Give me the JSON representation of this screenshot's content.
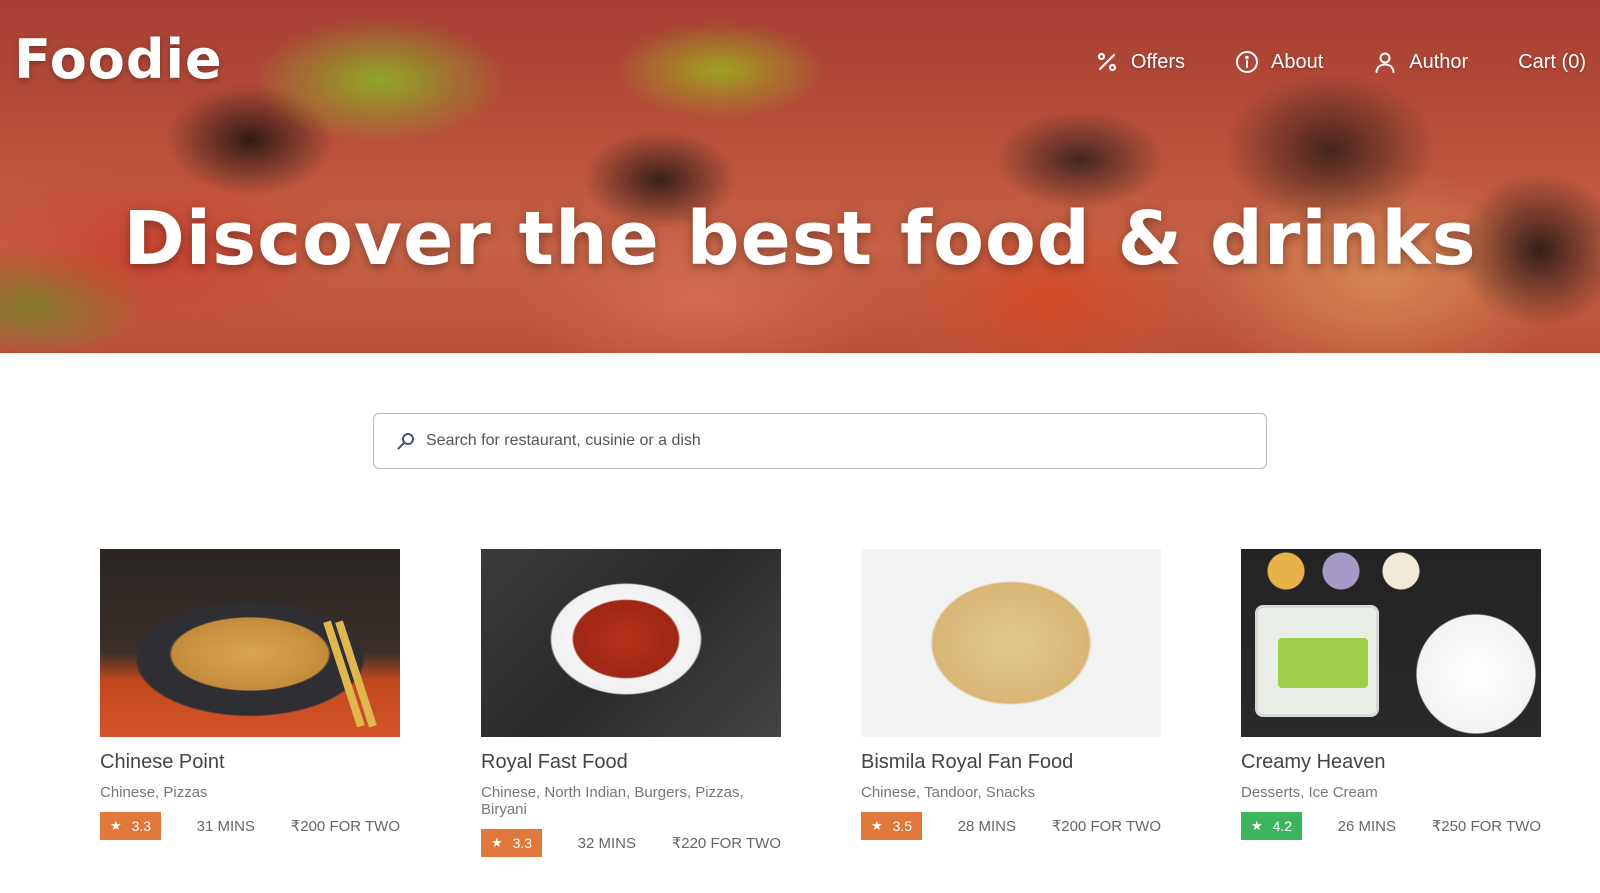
{
  "brand": {
    "logo": "Foodie"
  },
  "nav": {
    "offers_label": "Offers",
    "about_label": "About",
    "author_label": "Author",
    "cart_label": "Cart (0)"
  },
  "hero": {
    "title": "Discover the best food & drinks"
  },
  "search": {
    "placeholder": "Search for restaurant, cusinie or a dish",
    "value": ""
  },
  "restaurants": [
    {
      "name": "Chinese Point",
      "cuisine": "Chinese, Pizzas",
      "rating": "3.3",
      "rating_color": "#e0773b",
      "time": "31 MINS",
      "cost": "₹200 FOR TWO"
    },
    {
      "name": "Royal Fast Food",
      "cuisine": "Chinese, North Indian, Burgers, Pizzas, Biryani",
      "rating": "3.3",
      "rating_color": "#e0773b",
      "time": "32 MINS",
      "cost": "₹220 FOR TWO"
    },
    {
      "name": "Bismila Royal Fan Food",
      "cuisine": "Chinese, Tandoor, Snacks",
      "rating": "3.5",
      "rating_color": "#e0773b",
      "time": "28 MINS",
      "cost": "₹200 FOR TWO"
    },
    {
      "name": "Creamy Heaven",
      "cuisine": "Desserts, Ice Cream",
      "rating": "4.2",
      "rating_color": "#3cb55e",
      "time": "26 MINS",
      "cost": "₹250 FOR TWO"
    }
  ],
  "icons": {
    "star": "★"
  }
}
